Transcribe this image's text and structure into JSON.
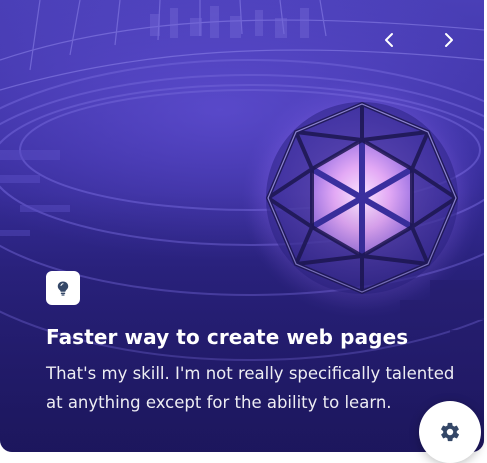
{
  "card": {
    "title": "Faster way to create web pages",
    "description": "That's my skill. I'm not really specifically talented at anything except for the ability to learn."
  },
  "carousel": {
    "prev_icon": "chevron-left-icon",
    "next_icon": "chevron-right-icon"
  },
  "badge_icon": "lightbulb-icon",
  "settings_icon": "gear-icon",
  "colors": {
    "accent": "#3a2f9f",
    "icon_dark": "#344767",
    "text": "#ffffff"
  }
}
